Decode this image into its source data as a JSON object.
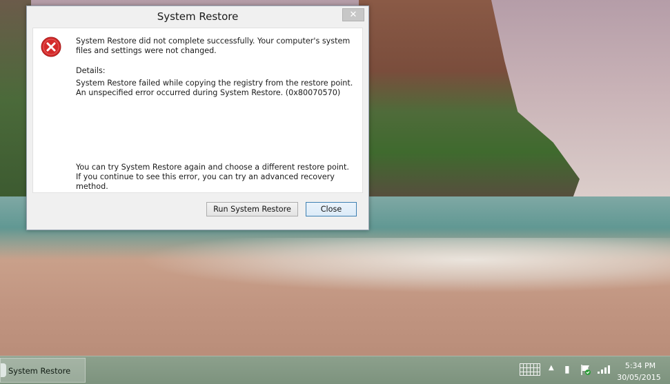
{
  "dialog": {
    "title": "System Restore",
    "close_glyph": "✕",
    "message": "System Restore did not complete successfully. Your computer's system files and settings were not changed.",
    "details_label": "Details:",
    "detail_line1": "System Restore failed while copying the registry from the restore point.",
    "detail_line2": "An unspecified error occurred during System Restore. (0x80070570)",
    "hint": "You can try System Restore again and choose a different restore point. If you continue to see this error, you can try an advanced recovery method.",
    "buttons": {
      "run_label": "Run System Restore",
      "close_label": "Close"
    },
    "icon": "error-icon"
  },
  "taskbar": {
    "task_label": "System Restore",
    "tray": {
      "icons": [
        "keyboard-icon",
        "chevron-up-icon",
        "power-icon",
        "action-center-flag-icon",
        "signal-icon"
      ],
      "chevron_glyph": "▲",
      "power_glyph": "▮"
    },
    "clock": {
      "time": "5:34 PM",
      "date": "30/05/2015"
    }
  },
  "colors": {
    "error_red": "#d42b2b",
    "close_btn_border": "#3c7fb1",
    "taskbar": "#8ca08c"
  }
}
